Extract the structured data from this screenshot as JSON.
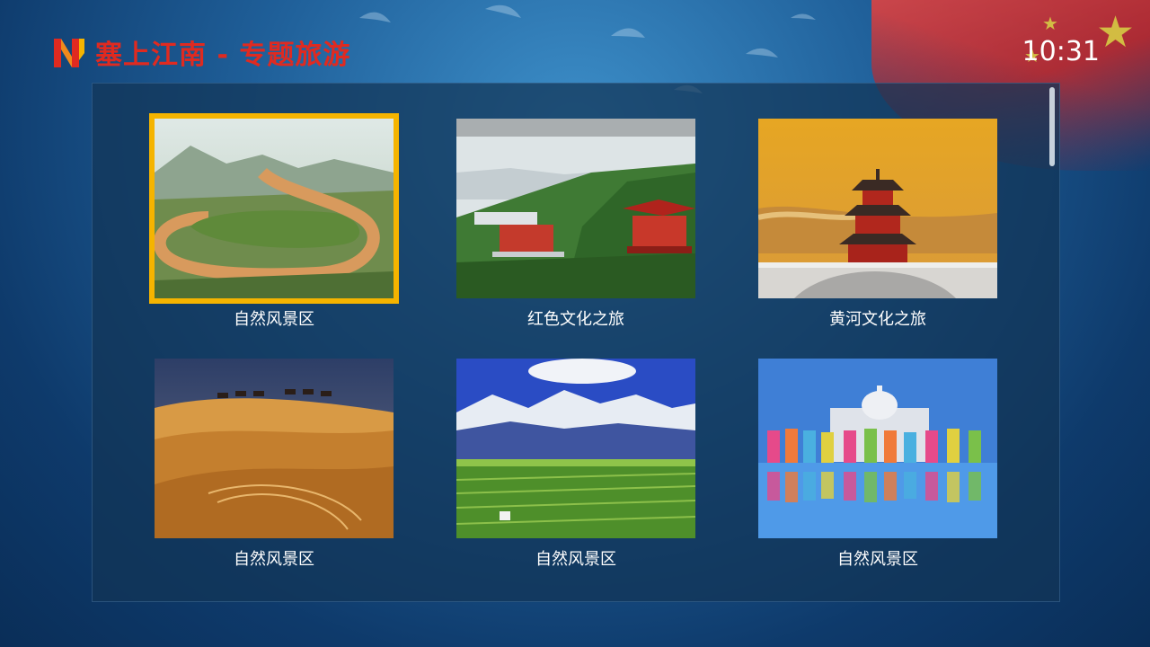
{
  "header": {
    "app_title": "塞上江南 - 专题旅游",
    "logo_icon": "n-logo-icon",
    "brand_color": "#e02a20"
  },
  "status": {
    "clock": "10:31"
  },
  "grid": {
    "focus_color": "#f5b400",
    "tiles": [
      {
        "label": "自然风景区",
        "focused": true,
        "image": "yellow-river-bend-photo"
      },
      {
        "label": "红色文化之旅",
        "focused": false,
        "image": "red-culture-mountain-photo"
      },
      {
        "label": "黄河文化之旅",
        "focused": false,
        "image": "yellow-river-pavilion-photo"
      },
      {
        "label": "自然风景区",
        "focused": false,
        "image": "desert-camel-caravan-photo"
      },
      {
        "label": "自然风景区",
        "focused": false,
        "image": "snow-mountain-farmland-photo"
      },
      {
        "label": "自然风景区",
        "focused": false,
        "image": "dancers-palace-reflection-photo"
      }
    ]
  }
}
